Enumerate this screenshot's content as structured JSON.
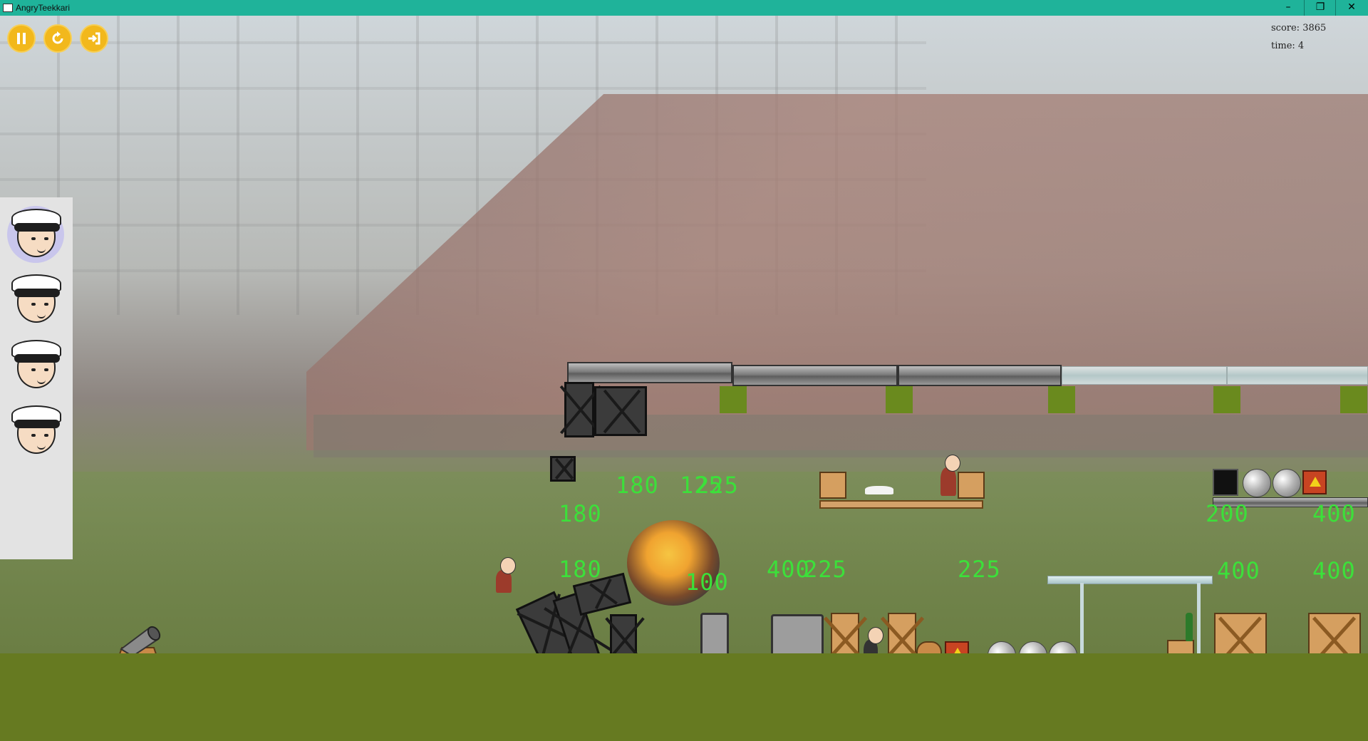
{
  "window": {
    "title": "AngryTeekkari",
    "minimize_glyph": "–",
    "maximize_glyph": "❐",
    "close_glyph": "✕"
  },
  "hud": {
    "score_text": "score: 3865",
    "time_text": "time: 4",
    "buttons": [
      {
        "name": "pause",
        "icon": "pause-icon"
      },
      {
        "name": "restart",
        "icon": "restart-icon"
      },
      {
        "name": "exit",
        "icon": "exit-icon"
      }
    ]
  },
  "ammo": {
    "remaining": 4,
    "active_index": 0,
    "character": "teekkari with white cap"
  },
  "debug_labels": [
    {
      "text": "180"
    },
    {
      "text": "125"
    },
    {
      "text": "225"
    },
    {
      "text": "180"
    },
    {
      "text": "180"
    },
    {
      "text": "100"
    },
    {
      "text": "400"
    },
    {
      "text": "225"
    },
    {
      "text": "225"
    },
    {
      "text": "200"
    },
    {
      "text": "400"
    },
    {
      "text": "400"
    },
    {
      "text": "400"
    },
    {
      "text": "400"
    }
  ],
  "colors": {
    "titlebar": "#1fb39a",
    "hud_button": "#f2b81c",
    "ground": "#667a21",
    "debug_text": "#3ce03a"
  }
}
